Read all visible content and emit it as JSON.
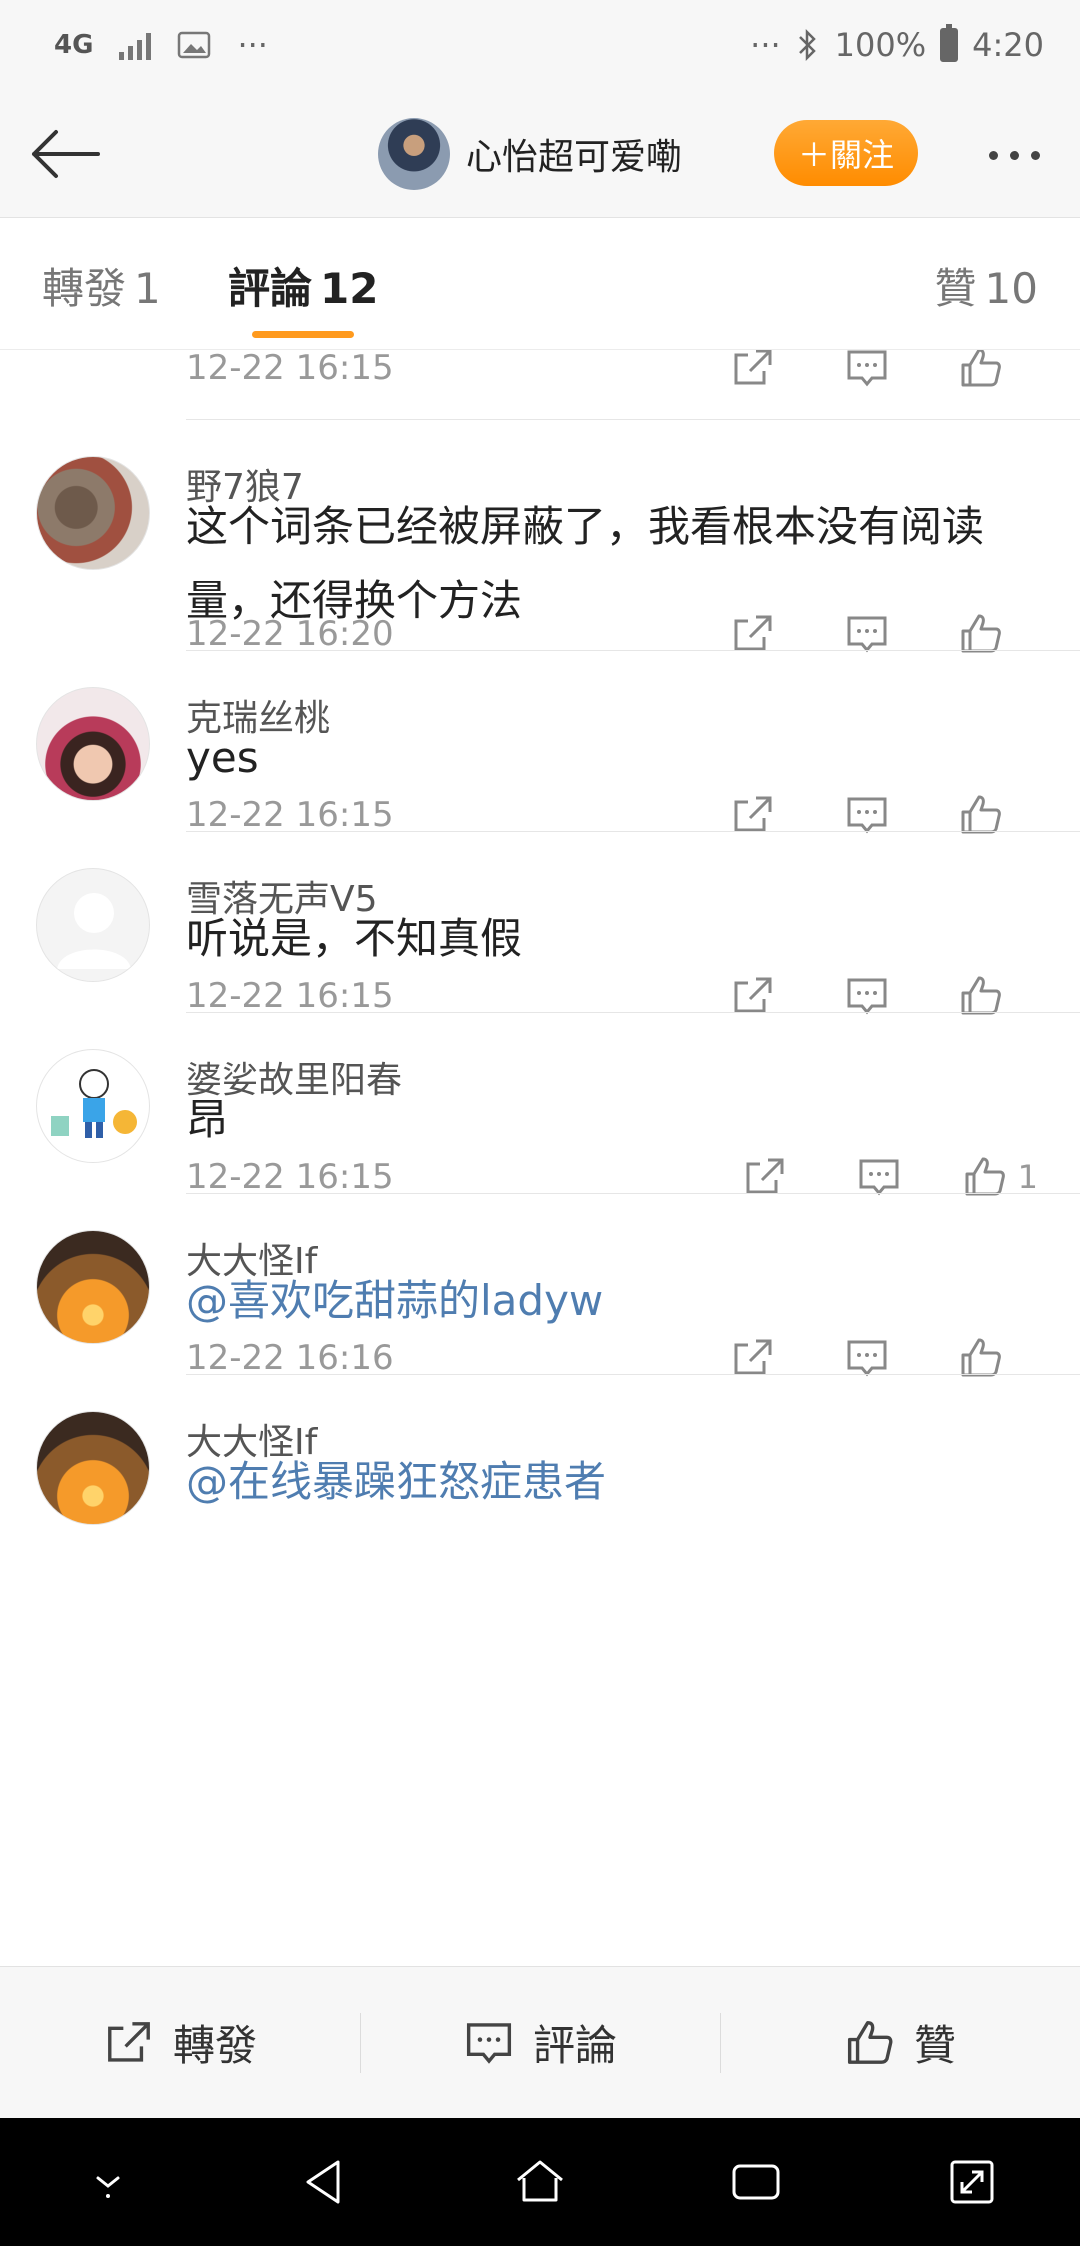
{
  "status_bar": {
    "network": "4G",
    "dots": "···",
    "battery": "100%",
    "time": "4:20"
  },
  "header": {
    "user_name": "心怡超可爱嘞",
    "follow_label": "＋關注"
  },
  "tabs": [
    {
      "label": "轉發",
      "count": "1"
    },
    {
      "label": "評論",
      "count": "12"
    },
    {
      "label": "贊",
      "count": "10"
    }
  ],
  "comments": [
    {
      "name": "",
      "text": "",
      "time": "12-22 16:15",
      "likes": ""
    },
    {
      "name": "野7狼7",
      "text": "这个词条已经被屏蔽了，我看根本没有阅读量，还得换个方法",
      "time": "12-22 16:20",
      "likes": ""
    },
    {
      "name": "克瑞丝桃",
      "text": "yes",
      "time": "12-22 16:15",
      "likes": ""
    },
    {
      "name": "雪落无声V5",
      "text": "听说是，不知真假",
      "time": "12-22 16:15",
      "likes": ""
    },
    {
      "name": "婆娑故里阳春",
      "text": "昂",
      "time": "12-22 16:15",
      "likes": "1"
    },
    {
      "name": "大大怪If",
      "text": "@喜欢吃甜蒜的ladyw",
      "time": "12-22 16:16",
      "likes": ""
    },
    {
      "name": "大大怪If",
      "text": "@在线暴躁狂怒症患者",
      "time": "",
      "likes": ""
    }
  ],
  "toolbar": {
    "repost_label": "轉發",
    "comment_label": "評論",
    "like_label": "贊"
  },
  "colors": {
    "accent": "#ff9a1e",
    "link": "#4f7db0",
    "muted": "#999999"
  }
}
